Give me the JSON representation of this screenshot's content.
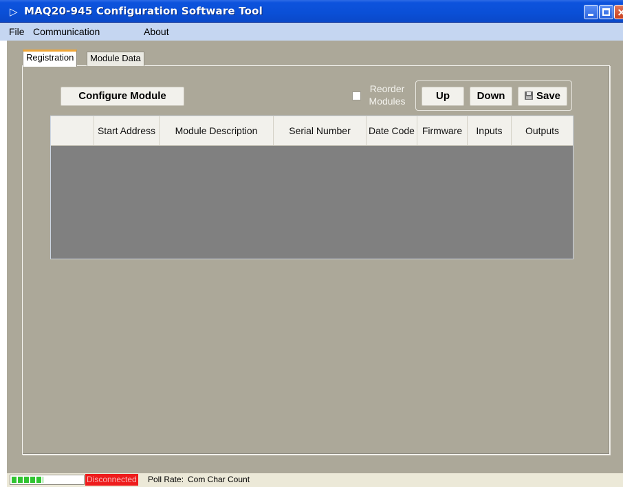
{
  "window": {
    "title": "MAQ20-945 Configuration Software Tool",
    "logo_glyph": "▷"
  },
  "menu": {
    "file": "File",
    "communication": "Communication",
    "about": "About"
  },
  "tabs": {
    "registration": "Registration",
    "module_data": "Module Data"
  },
  "toolbar": {
    "configure_label": "Configure Module",
    "reorder_label": "Reorder Modules",
    "reorder_checked": false,
    "up_label": "Up",
    "down_label": "Down",
    "save_label": "Save"
  },
  "grid": {
    "columns": [
      "",
      "Start Address",
      "Module Description",
      "Serial Number",
      "Date Code",
      "Firmware",
      "Inputs",
      "Outputs"
    ],
    "rows": []
  },
  "status": {
    "progress_fraction": 0.45,
    "connection": "Disconnected",
    "poll_rate": "Poll Rate:",
    "com_char_count": "Com Char Count"
  },
  "colors": {
    "titlebar": "#0a4fd6",
    "menubar": "#c5d6f1",
    "client": "#aca899",
    "grid_body": "#808080",
    "disconnected": "#ee1c1c",
    "active_tab_accent": "#f0a637"
  }
}
